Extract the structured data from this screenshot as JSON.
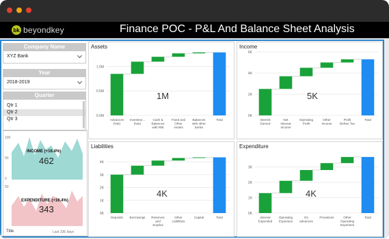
{
  "app": {
    "logo_text": "beyondkey",
    "logo_mark": "bk",
    "title": "Finance POC - P&L And Balance Sheet Analysis"
  },
  "window_dots": [
    "#e2422f",
    "#f2a318",
    "#e2422f"
  ],
  "slicers": {
    "company": {
      "header": "Company Name",
      "value": "XYZ Bank"
    },
    "year": {
      "header": "Year",
      "value": "2018-2019"
    },
    "quarter": {
      "header": "Quarter",
      "items": [
        "Qtr 1",
        "Qtr 2",
        "Qtr 3"
      ],
      "selected": "Qtr 2"
    }
  },
  "sparklines": {
    "income": {
      "label": "INCOME (+16.4%)",
      "value": "462",
      "color": "#9ed9d4"
    },
    "expenditure": {
      "label": "EXPENDITURE (+16.4%)",
      "value": "343",
      "color": "#f2c4c8"
    },
    "axis": {
      "top": "100",
      "mid": "50",
      "zero": "0",
      "top2": "50"
    },
    "footer_left": "Title",
    "footer_right": "Last 336 days"
  },
  "colors": {
    "positive": "#1aa23a",
    "total": "#1e8cf0",
    "accent_border": "#2b83c9"
  },
  "chart_data": [
    {
      "type": "bar",
      "title": "Assets",
      "card_value": "1M",
      "categories": [
        "Advances (Net)",
        "Investme... (Net)",
        "Cash & Balances with RBI",
        "Fixed and Other Assets",
        "Balances with other banks",
        "Total"
      ],
      "values": [
        0.85,
        0.25,
        0.1,
        0.07,
        0.02,
        1.29
      ],
      "ylim": [
        0,
        1.3
      ],
      "yticks": [
        "1.0M",
        "0.5M",
        "0.0M"
      ],
      "ytick_values": [
        1.0,
        0.5,
        0.0
      ]
    },
    {
      "type": "bar",
      "title": "Income",
      "card_value": "5K",
      "categories": [
        "Interest Earned",
        "Net Interest Income",
        "Operating Profit",
        "Other Income",
        "Profit Before Tax",
        "Total"
      ],
      "values": [
        2.5,
        1.2,
        0.8,
        0.5,
        0.3,
        5.3
      ],
      "ylim": [
        0,
        6.0
      ],
      "yticks": [
        "6K",
        "4K",
        "2K",
        "0K"
      ],
      "ytick_values": [
        6,
        4,
        2,
        0
      ]
    },
    {
      "type": "bar",
      "title": "Liabilities",
      "card_value": "4K",
      "categories": [
        "Deposits",
        "Borrowings",
        "Reserves and Surplus",
        "Other Liabilities",
        "Capital",
        "Total"
      ],
      "values": [
        3.0,
        0.7,
        0.4,
        0.2,
        0.05,
        4.35
      ],
      "ylim": [
        0,
        4.8
      ],
      "yticks": [
        "4K",
        "3K",
        "2K",
        "1K",
        "0K"
      ],
      "ytick_values": [
        4,
        3,
        2,
        1,
        0
      ]
    },
    {
      "type": "bar",
      "title": "Expenditure",
      "card_value": "4K",
      "categories": [
        "Interest Expended",
        "Operating Expenses",
        "On advances",
        "Provisions",
        "Other Operating Expenses",
        "Total"
      ],
      "values": [
        1.3,
        0.8,
        0.7,
        0.45,
        0.4,
        3.65
      ],
      "ylim": [
        0,
        4.0
      ],
      "yticks": [
        "3K",
        "2K",
        "1K",
        "0K"
      ],
      "ytick_values": [
        3,
        2,
        1,
        0
      ]
    }
  ]
}
